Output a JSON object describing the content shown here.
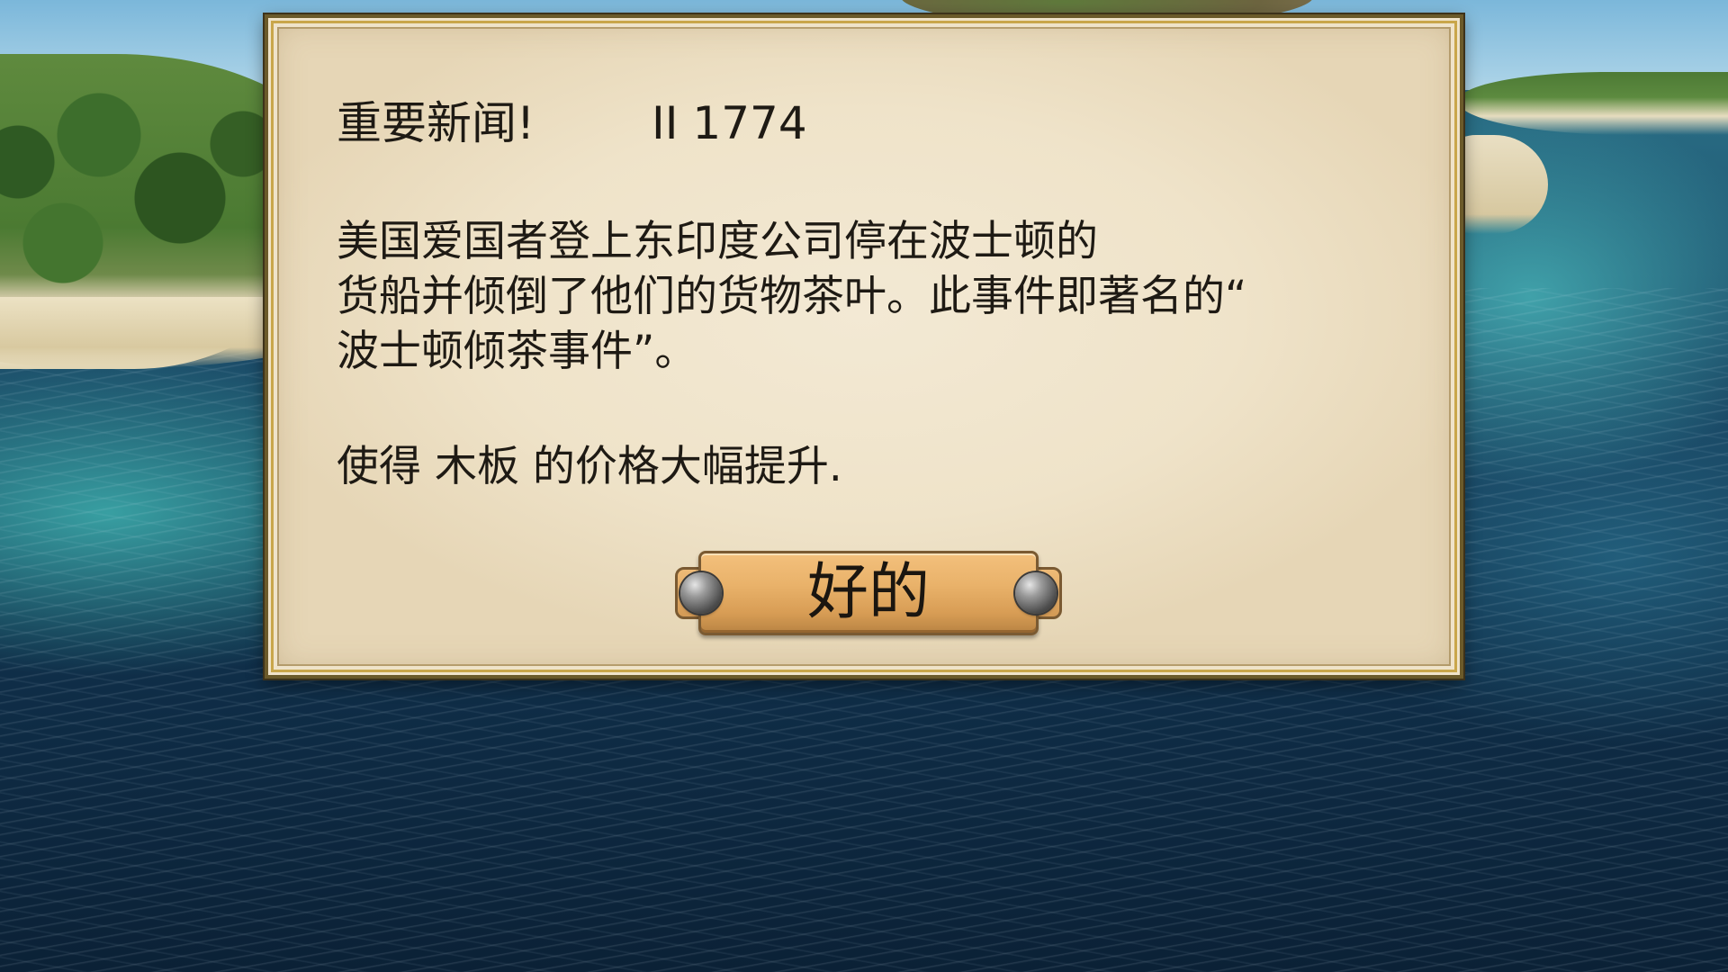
{
  "dialog": {
    "headline": "重要新闻!",
    "date": "II 1774",
    "body_lines": [
      "美国爱国者登上东印度公司停在波士顿的",
      "货船并倾倒了他们的货物茶叶。此事件即著名的“",
      "波士顿倾茶事件”。"
    ],
    "effect": "使得 木板 的价格大幅提升.",
    "ok_label": "好的"
  },
  "colors": {
    "parchment": "#efe3c9",
    "frame_gold": "#c9a64a",
    "button_brass": "#e9b26a",
    "text": "#1e1a14"
  },
  "icons": {
    "button_decorations": [
      "rivet-icon",
      "rivet-icon"
    ]
  }
}
